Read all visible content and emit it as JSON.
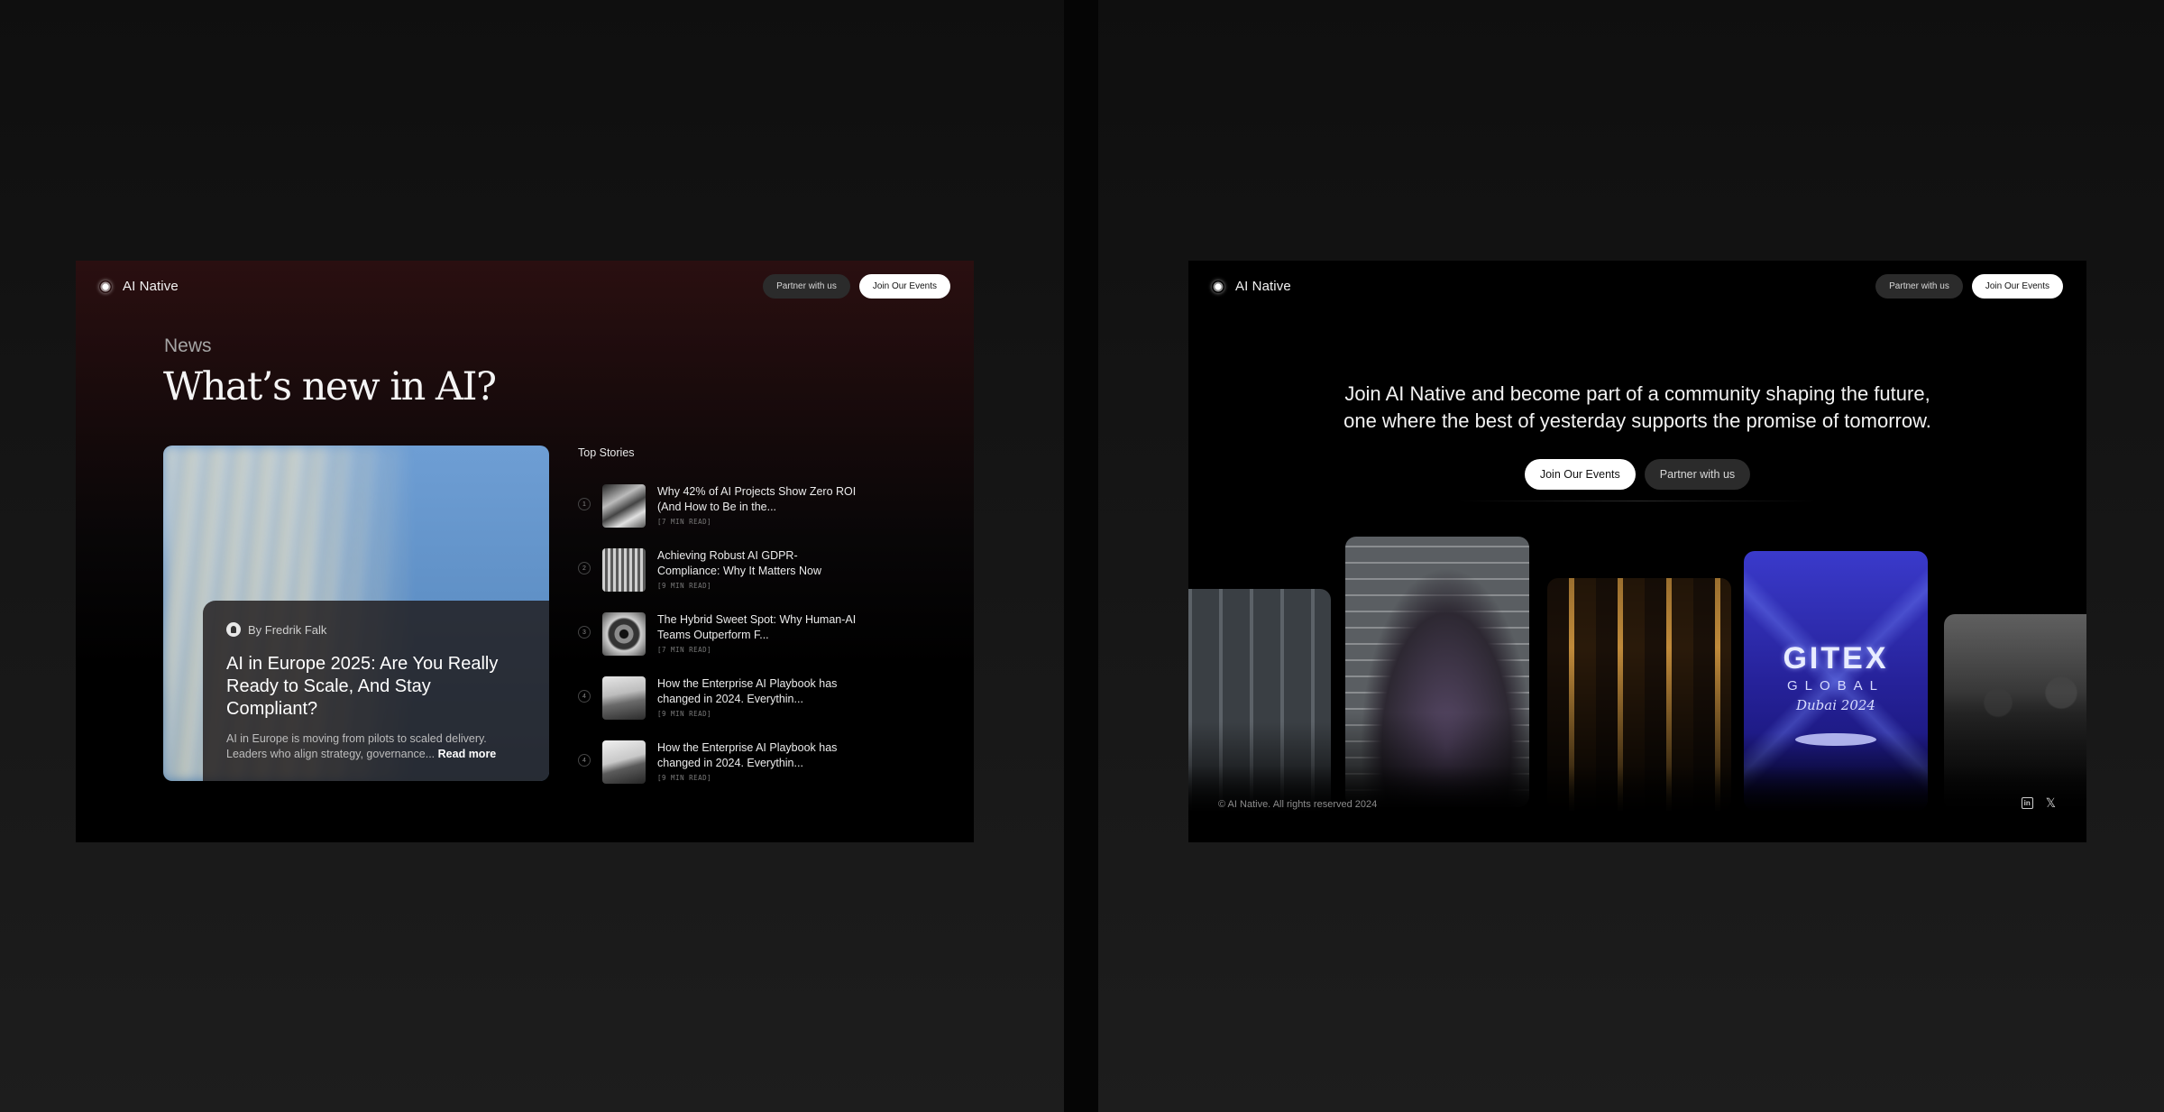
{
  "brand": {
    "name": "AI Native"
  },
  "left_panel": {
    "nav": {
      "partner_label": "Partner with us",
      "join_label": "Join Our Events"
    },
    "section_label": "News",
    "heading": "What’s new in AI?",
    "featured": {
      "author": "By Fredrik Falk",
      "headline": "AI in Europe 2025: Are You Really Ready to Scale, And Stay Compliant?",
      "excerpt": "AI in Europe is moving from pilots to scaled delivery. Leaders who align strategy, governance...",
      "read_more": "Read more"
    },
    "top_stories_label": "Top Stories",
    "stories": [
      {
        "num": "1",
        "title": "Why 42% of AI Projects Show Zero ROI (And How to Be in the...",
        "meta": "[7 MIN READ]"
      },
      {
        "num": "2",
        "title": "Achieving Robust AI GDPR-Compliance: Why It Matters Now",
        "meta": "[9 MIN READ]"
      },
      {
        "num": "3",
        "title": "The Hybrid Sweet Spot: Why Human-AI Teams Outperform F...",
        "meta": "[7 MIN READ]"
      },
      {
        "num": "4",
        "title": "How the Enterprise AI Playbook has changed in 2024. Everythin...",
        "meta": "[9 MIN READ]"
      },
      {
        "num": "4",
        "title": "How the Enterprise AI Playbook has changed in 2024. Everythin...",
        "meta": "[9 MIN READ]"
      }
    ]
  },
  "right_panel": {
    "nav": {
      "partner_label": "Partner with us",
      "join_label": "Join Our Events"
    },
    "hero_line1": "Join AI Native and become part of a community shaping the future,",
    "hero_line2": "one where the best of yesterday supports the promise of tomorrow.",
    "cta_join": "Join Our Events",
    "cta_partner": "Partner with us",
    "gitex": {
      "title": "GITEX",
      "subtitle": "GLOBAL",
      "city": "Dubai 2024"
    },
    "footer": "© AI Native. All rights reserved 2024",
    "socials": [
      "linkedin-icon",
      "x-icon"
    ]
  }
}
